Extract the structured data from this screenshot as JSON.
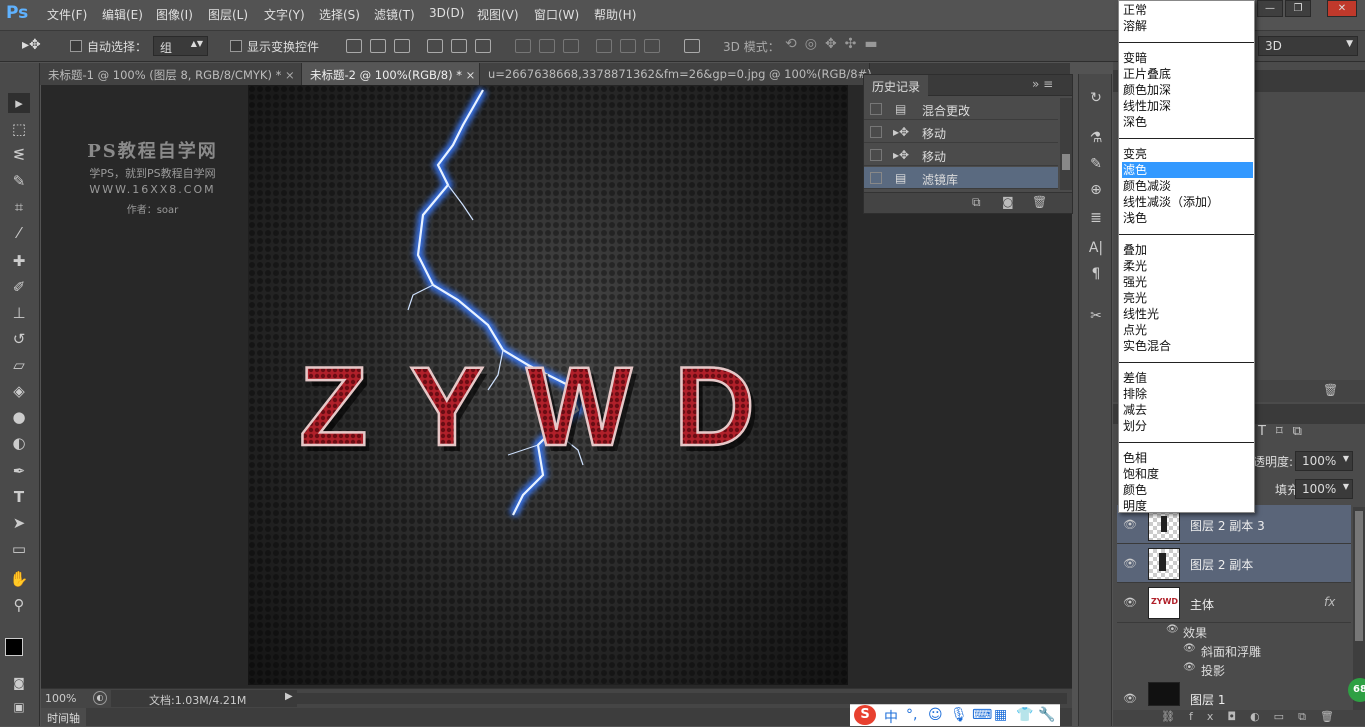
{
  "app": {
    "logo": "Ps"
  },
  "menu": [
    "文件(F)",
    "编辑(E)",
    "图像(I)",
    "图层(L)",
    "文字(Y)",
    "选择(S)",
    "滤镜(T)",
    "3D(D)",
    "视图(V)",
    "窗口(W)",
    "帮助(H)"
  ],
  "options": {
    "auto_select_label": "自动选择：",
    "auto_select_value": "组",
    "show_transform_label": "显示变换控件",
    "mode3d_label": "3D 模式：",
    "workspace_value": "3D"
  },
  "tabs": [
    {
      "label": "未标题-1 @ 100% (图层 8, RGB/8/CMYK) *"
    },
    {
      "label": "未标题-2 @ 100%(RGB/8) *"
    },
    {
      "label": "u=2667638668,3378871362&fm=26&gp=0.jpg @ 100%(RGB/8#)"
    }
  ],
  "watermark": {
    "line1": "PS教程自学网",
    "line2": "学PS，就到PS教程自学网",
    "line3": "WWW.16XX8.COM",
    "line4": "作者：soar"
  },
  "canvas_text": "ZYWD",
  "status": {
    "zoom": "100%",
    "doc": "文档:1.03M/4.21M"
  },
  "timeline_label": "时间轴",
  "history": {
    "title": "历史记录",
    "items": [
      "混合更改",
      "移动",
      "移动",
      "滤镜库"
    ]
  },
  "blend_menu": {
    "groups": [
      [
        "正常",
        "溶解"
      ],
      [
        "变暗",
        "正片叠底",
        "颜色加深",
        "线性加深",
        "深色"
      ],
      [
        "变亮",
        "滤色",
        "颜色减淡",
        "线性减淡（添加）",
        "浅色"
      ],
      [
        "叠加",
        "柔光",
        "强光",
        "亮光",
        "线性光",
        "点光",
        "实色混合"
      ],
      [
        "差值",
        "排除",
        "减去",
        "划分"
      ],
      [
        "色相",
        "饱和度",
        "颜色",
        "明度"
      ]
    ],
    "selected": "滤色"
  },
  "layers_panel": {
    "opacity_label": "透明度:",
    "opacity_value": "100%",
    "fill_label": "填充:",
    "fill_value": "100%",
    "layers": [
      {
        "name": "图层 2 副本 3"
      },
      {
        "name": "图层 2 副本"
      },
      {
        "name": "主体",
        "fx": "fx"
      },
      {
        "name": "图层 1"
      }
    ],
    "effects_label": "效果",
    "effect_items": [
      "斜面和浮雕",
      "投影"
    ]
  },
  "tray_badge": "68"
}
